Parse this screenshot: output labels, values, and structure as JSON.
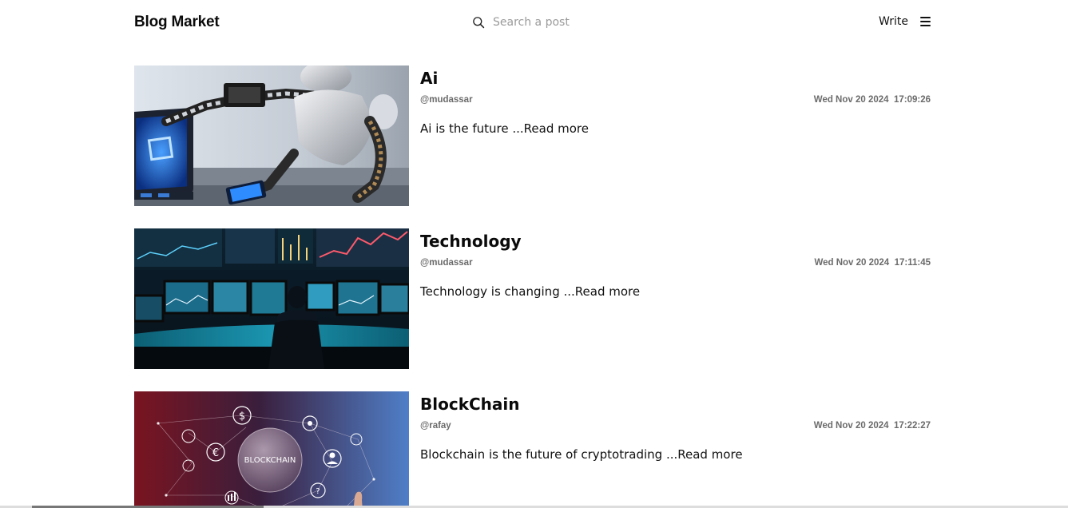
{
  "header": {
    "brand": "Blog Market",
    "search_placeholder": "Search a post",
    "write_label": "Write"
  },
  "posts": [
    {
      "title": "Ai",
      "author": "@mudassar",
      "date": "Wed Nov 20 2024",
      "time": "17:09:26",
      "excerpt": "Ai is the future ",
      "read_more": "...Read more",
      "image": "robot-with-monitor"
    },
    {
      "title": "Technology",
      "author": "@mudassar",
      "date": "Wed Nov 20 2024",
      "time": "17:11:45",
      "excerpt": "Technology is changing ",
      "read_more": "...Read more",
      "image": "trading-desk-monitors"
    },
    {
      "title": "BlockChain",
      "author": "@rafay",
      "date": "Wed Nov 20 2024",
      "time": "17:22:27",
      "excerpt": "Blockchain is the future of cryptotrading ",
      "read_more": "...Read more",
      "image": "blockchain-network",
      "image_text": "BLOCKCHAIN"
    }
  ]
}
